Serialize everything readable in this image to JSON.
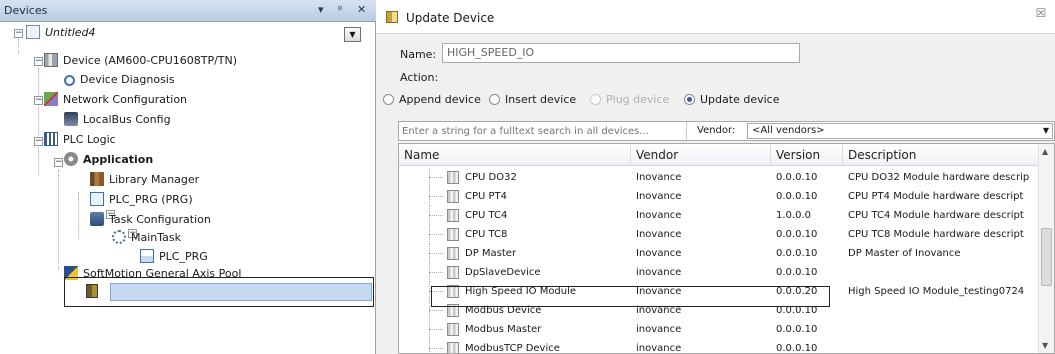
{
  "devices_panel": {
    "title": "Devices",
    "pin": "▾",
    "pushpin": "ᵖ",
    "close": "✕",
    "tree": {
      "root": "Untitled4",
      "device": "Device (AM600-CPU1608TP/TN)",
      "device_diagnosis": "Device Diagnosis",
      "network_configuration": "Network Configuration",
      "localbus_config": "LocalBus Config",
      "plc_logic": "PLC Logic",
      "application": "Application",
      "library_manager": "Library Manager",
      "plc_prg": "PLC_PRG (PRG)",
      "task_configuration": "Task Configuration",
      "main_task": "MainTask",
      "plc_prg_call": "PLC_PRG",
      "softmotion_pool": "SoftMotion General Axis Pool"
    }
  },
  "dialog": {
    "title": "Update Device",
    "close": "☒",
    "name_label": "Name:",
    "name_value": "HIGH_SPEED_IO",
    "action_label": "Action:",
    "actions": [
      {
        "label": "Append device",
        "selected": false,
        "enabled": true
      },
      {
        "label": "Insert device",
        "selected": false,
        "enabled": true
      },
      {
        "label": "Plug device",
        "selected": false,
        "enabled": false
      },
      {
        "label": "Update device",
        "selected": true,
        "enabled": true
      }
    ],
    "search_placeholder": "Enter a string for a fulltext search in all devices...",
    "vendor_label": "Vendor:",
    "vendor_value": "<All vendors>",
    "columns": [
      "Name",
      "Vendor",
      "Version",
      "Description"
    ],
    "rows": [
      {
        "name": "CPU DO32",
        "vendor": "Inovance",
        "version": "0.0.0.10",
        "description": "CPU DO32 Module hardware descrip"
      },
      {
        "name": "CPU PT4",
        "vendor": "Inovance",
        "version": "0.0.0.10",
        "description": "CPU PT4 Module hardware descript"
      },
      {
        "name": "CPU TC4",
        "vendor": "Inovance",
        "version": "1.0.0.0",
        "description": "CPU TC4 Module hardware descript"
      },
      {
        "name": "CPU TC8",
        "vendor": "Inovance",
        "version": "0.0.0.10",
        "description": "CPU TC8 Module hardware descript"
      },
      {
        "name": "DP Master",
        "vendor": "Inovance",
        "version": "0.0.0.10",
        "description": "DP Master of Inovance"
      },
      {
        "name": "DpSlaveDevice",
        "vendor": "inovance",
        "version": "0.0.0.10",
        "description": ""
      },
      {
        "name": "High Speed IO Module",
        "vendor": "Inovance",
        "version": "0.0.0.20",
        "description": "High Speed IO Module_testing0724"
      },
      {
        "name": "Modbus Device",
        "vendor": "inovance",
        "version": "0.0.0.10",
        "description": ""
      },
      {
        "name": "Modbus Master",
        "vendor": "inovance",
        "version": "0.0.0.10",
        "description": ""
      },
      {
        "name": "ModbusTCP Device",
        "vendor": "inovance",
        "version": "0.0.0.10",
        "description": ""
      }
    ],
    "selected_row": 6
  }
}
